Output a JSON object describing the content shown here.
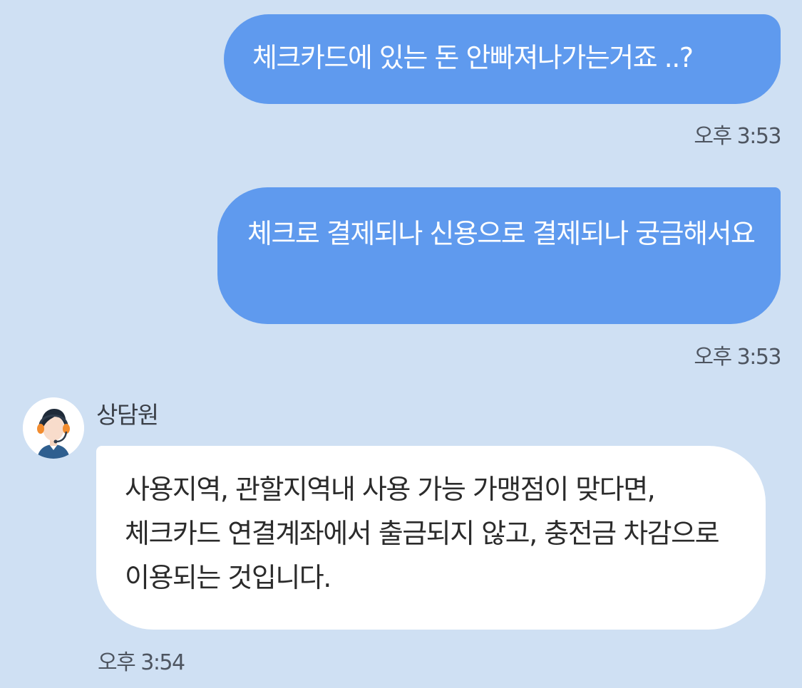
{
  "messages": [
    {
      "direction": "outgoing",
      "text": "체크카드에 있는 돈 안빠져나가는거죠 ..?",
      "time": "오후 3:53"
    },
    {
      "direction": "outgoing",
      "text": "체크로 결제되나 신용으로 결제되나 궁금해서요",
      "time": "오후 3:53"
    },
    {
      "direction": "incoming",
      "sender": "상담원",
      "avatar_icon": "agent-headset-avatar-icon",
      "text": "사용지역, 관할지역내 사용 가능 가맹점이 맞다면, 체크카드 연결계좌에서 출금되지 않고, 충전금 차감으로 이용되는 것입니다.",
      "time": "오후 3:54"
    }
  ],
  "colors": {
    "background": "#cfe0f3",
    "outgoing_bubble": "#5f9aee",
    "incoming_bubble": "#ffffff",
    "timestamp": "#4e5560"
  }
}
